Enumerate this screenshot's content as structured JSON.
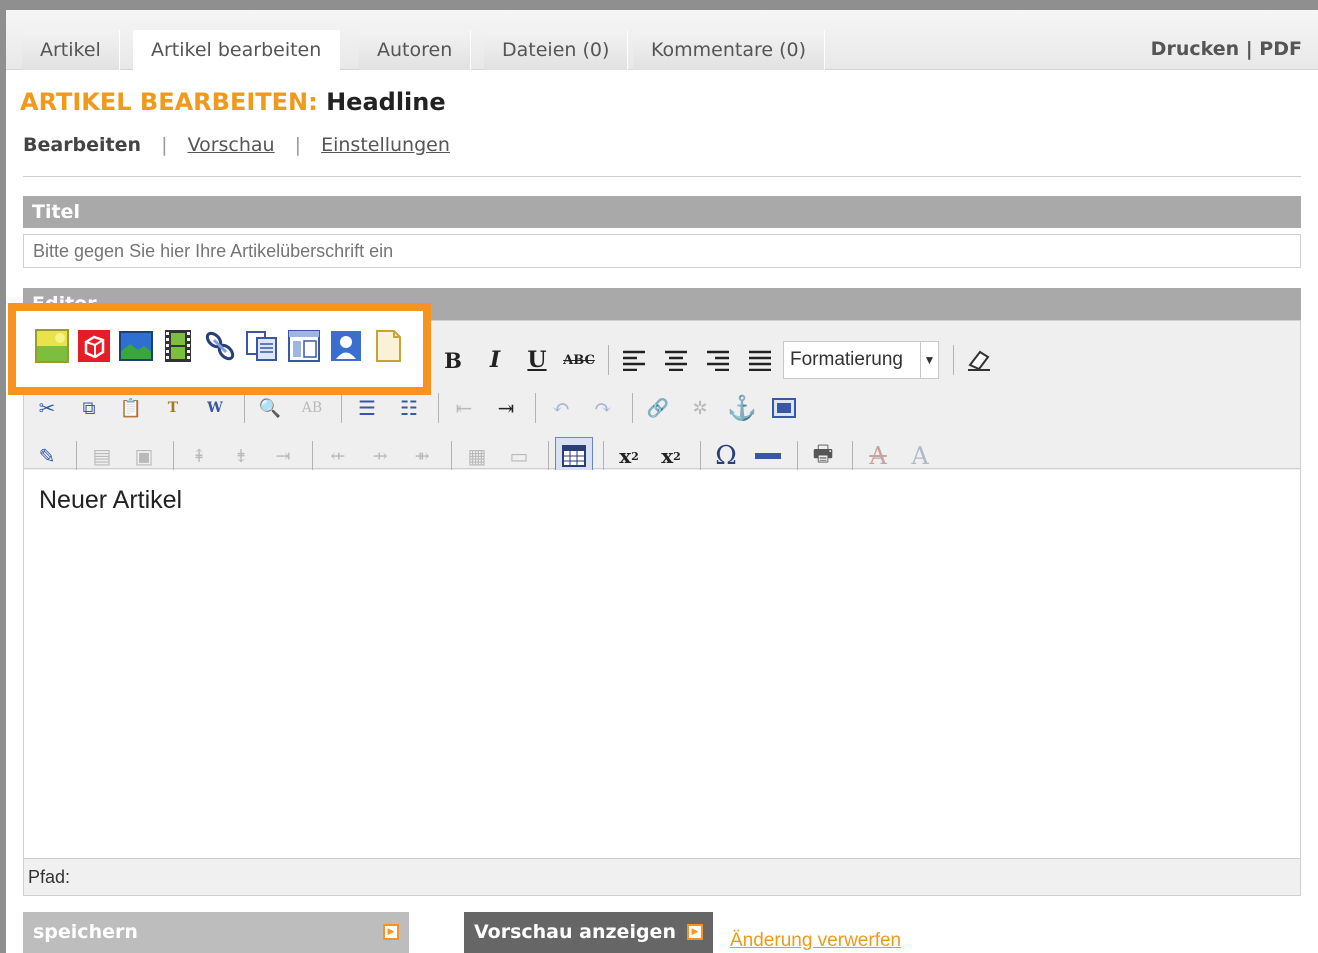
{
  "tabs": [
    "Artikel",
    "Artikel bearbeiten",
    "Autoren",
    "Dateien (0)",
    "Kommentare (0)"
  ],
  "print_pdf": "Drucken | PDF",
  "heading": {
    "prefix": "ARTIKEL BEARBEITEN:",
    "title": "Headline"
  },
  "subnav": {
    "current": "Bearbeiten",
    "preview": "Vorschau",
    "settings": "Einstellungen"
  },
  "title_section": {
    "label": "Titel",
    "placeholder": "Bitte gegen Sie hier Ihre Artikelüberschrift ein"
  },
  "editor_section": {
    "label": "Editor"
  },
  "toolbar": {
    "format_select": "Formatierung"
  },
  "editor": {
    "content": "Neuer Artikel",
    "path_label": "Pfad:"
  },
  "buttons": {
    "save": "speichern",
    "preview": "Vorschau anzeigen",
    "discard": "Änderung verwerfen"
  },
  "colors": {
    "accent": "#f7931e",
    "heading_prefix": "#ef9a1c",
    "section_header": "#a9a9a9"
  }
}
